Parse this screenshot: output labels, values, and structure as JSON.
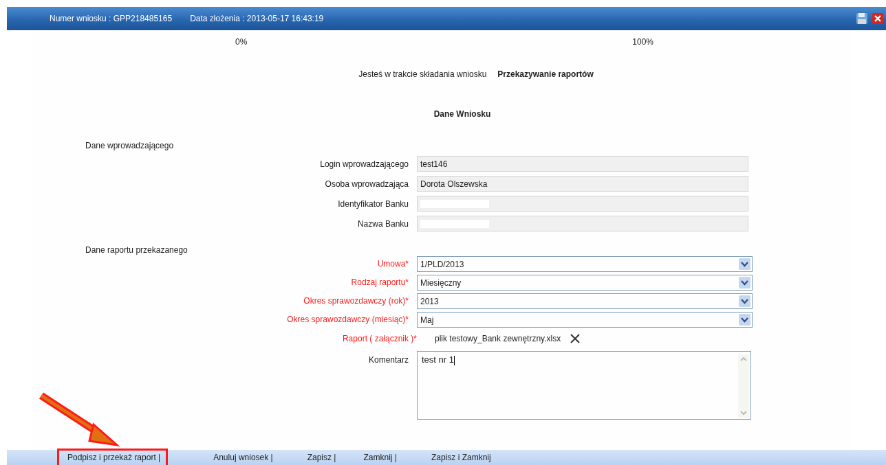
{
  "header": {
    "fields": [
      {
        "label": "Numer wniosku :",
        "value": "GPP218485165"
      },
      {
        "label": "Data złożenia :",
        "value": "2013-05-17 16:43:19"
      }
    ]
  },
  "progress": {
    "start": "0%",
    "end": "100%"
  },
  "status": {
    "text": "Jesteś w trakcie składania wniosku",
    "step": "Przekazywanie raportów"
  },
  "title": "Dane Wniosku",
  "sections": [
    {
      "heading": "Dane wprowadzającego",
      "fields": [
        {
          "kind": "readonly",
          "label": "Login wprowadzającego",
          "required": false,
          "value": "test146",
          "redacted": false
        },
        {
          "kind": "readonly",
          "label": "Osoba wprowadzająca",
          "required": false,
          "value": "Dorota Olszewska",
          "redacted": false
        },
        {
          "kind": "readonly",
          "label": "Identyfikator Banku",
          "required": false,
          "redacted": true
        },
        {
          "kind": "readonly",
          "label": "Nazwa Banku",
          "required": false,
          "redacted": true
        }
      ]
    },
    {
      "heading": "Dane raportu przekazanego",
      "fields": [
        {
          "kind": "select",
          "label": "Umowa*",
          "required": true,
          "value": "1/PLD/2013"
        },
        {
          "kind": "select",
          "label": "Rodzaj raportu*",
          "required": true,
          "value": "Miesięczny"
        },
        {
          "kind": "select",
          "label": "Okres sprawozdawczy (rok)*",
          "required": true,
          "value": "2013"
        },
        {
          "kind": "select",
          "label": "Okres sprawozdawczy (miesiąc)*",
          "required": true,
          "value": "Maj"
        },
        {
          "kind": "file",
          "label": "Raport ( załącznik )*",
          "required": true,
          "value": "plik testowy_Bank zewnętrzny.xlsx"
        },
        {
          "kind": "textarea",
          "label": "Komentarz",
          "required": false,
          "value": "test nr 1"
        }
      ]
    }
  ],
  "footer": {
    "actions": [
      {
        "label": "Podpisz i przekaż raport |",
        "highlighted": true
      },
      {
        "label": "Anuluj wniosek |",
        "highlighted": false
      },
      {
        "label": "Zapisz |",
        "highlighted": false
      },
      {
        "label": "Zamknij |",
        "highlighted": false
      },
      {
        "label": "Zapisz i Zamknij",
        "highlighted": false
      }
    ]
  }
}
